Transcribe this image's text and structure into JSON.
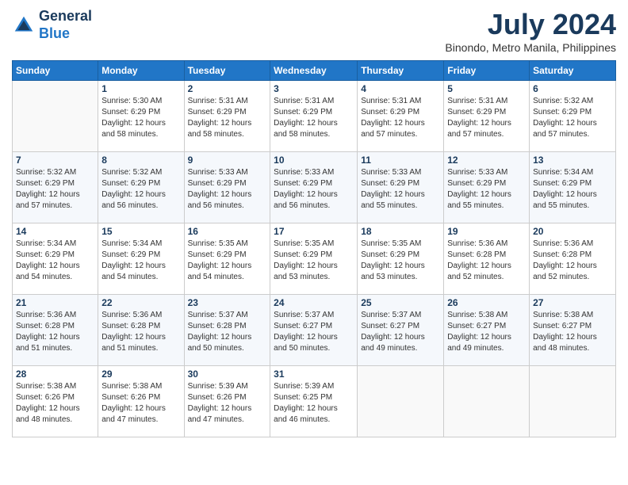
{
  "header": {
    "logo_line1": "General",
    "logo_line2": "Blue",
    "month": "July 2024",
    "location": "Binondo, Metro Manila, Philippines"
  },
  "days_of_week": [
    "Sunday",
    "Monday",
    "Tuesday",
    "Wednesday",
    "Thursday",
    "Friday",
    "Saturday"
  ],
  "weeks": [
    [
      {
        "day": "",
        "info": ""
      },
      {
        "day": "1",
        "info": "Sunrise: 5:30 AM\nSunset: 6:29 PM\nDaylight: 12 hours\nand 58 minutes."
      },
      {
        "day": "2",
        "info": "Sunrise: 5:31 AM\nSunset: 6:29 PM\nDaylight: 12 hours\nand 58 minutes."
      },
      {
        "day": "3",
        "info": "Sunrise: 5:31 AM\nSunset: 6:29 PM\nDaylight: 12 hours\nand 58 minutes."
      },
      {
        "day": "4",
        "info": "Sunrise: 5:31 AM\nSunset: 6:29 PM\nDaylight: 12 hours\nand 57 minutes."
      },
      {
        "day": "5",
        "info": "Sunrise: 5:31 AM\nSunset: 6:29 PM\nDaylight: 12 hours\nand 57 minutes."
      },
      {
        "day": "6",
        "info": "Sunrise: 5:32 AM\nSunset: 6:29 PM\nDaylight: 12 hours\nand 57 minutes."
      }
    ],
    [
      {
        "day": "7",
        "info": "Sunrise: 5:32 AM\nSunset: 6:29 PM\nDaylight: 12 hours\nand 57 minutes."
      },
      {
        "day": "8",
        "info": "Sunrise: 5:32 AM\nSunset: 6:29 PM\nDaylight: 12 hours\nand 56 minutes."
      },
      {
        "day": "9",
        "info": "Sunrise: 5:33 AM\nSunset: 6:29 PM\nDaylight: 12 hours\nand 56 minutes."
      },
      {
        "day": "10",
        "info": "Sunrise: 5:33 AM\nSunset: 6:29 PM\nDaylight: 12 hours\nand 56 minutes."
      },
      {
        "day": "11",
        "info": "Sunrise: 5:33 AM\nSunset: 6:29 PM\nDaylight: 12 hours\nand 55 minutes."
      },
      {
        "day": "12",
        "info": "Sunrise: 5:33 AM\nSunset: 6:29 PM\nDaylight: 12 hours\nand 55 minutes."
      },
      {
        "day": "13",
        "info": "Sunrise: 5:34 AM\nSunset: 6:29 PM\nDaylight: 12 hours\nand 55 minutes."
      }
    ],
    [
      {
        "day": "14",
        "info": "Sunrise: 5:34 AM\nSunset: 6:29 PM\nDaylight: 12 hours\nand 54 minutes."
      },
      {
        "day": "15",
        "info": "Sunrise: 5:34 AM\nSunset: 6:29 PM\nDaylight: 12 hours\nand 54 minutes."
      },
      {
        "day": "16",
        "info": "Sunrise: 5:35 AM\nSunset: 6:29 PM\nDaylight: 12 hours\nand 54 minutes."
      },
      {
        "day": "17",
        "info": "Sunrise: 5:35 AM\nSunset: 6:29 PM\nDaylight: 12 hours\nand 53 minutes."
      },
      {
        "day": "18",
        "info": "Sunrise: 5:35 AM\nSunset: 6:29 PM\nDaylight: 12 hours\nand 53 minutes."
      },
      {
        "day": "19",
        "info": "Sunrise: 5:36 AM\nSunset: 6:28 PM\nDaylight: 12 hours\nand 52 minutes."
      },
      {
        "day": "20",
        "info": "Sunrise: 5:36 AM\nSunset: 6:28 PM\nDaylight: 12 hours\nand 52 minutes."
      }
    ],
    [
      {
        "day": "21",
        "info": "Sunrise: 5:36 AM\nSunset: 6:28 PM\nDaylight: 12 hours\nand 51 minutes."
      },
      {
        "day": "22",
        "info": "Sunrise: 5:36 AM\nSunset: 6:28 PM\nDaylight: 12 hours\nand 51 minutes."
      },
      {
        "day": "23",
        "info": "Sunrise: 5:37 AM\nSunset: 6:28 PM\nDaylight: 12 hours\nand 50 minutes."
      },
      {
        "day": "24",
        "info": "Sunrise: 5:37 AM\nSunset: 6:27 PM\nDaylight: 12 hours\nand 50 minutes."
      },
      {
        "day": "25",
        "info": "Sunrise: 5:37 AM\nSunset: 6:27 PM\nDaylight: 12 hours\nand 49 minutes."
      },
      {
        "day": "26",
        "info": "Sunrise: 5:38 AM\nSunset: 6:27 PM\nDaylight: 12 hours\nand 49 minutes."
      },
      {
        "day": "27",
        "info": "Sunrise: 5:38 AM\nSunset: 6:27 PM\nDaylight: 12 hours\nand 48 minutes."
      }
    ],
    [
      {
        "day": "28",
        "info": "Sunrise: 5:38 AM\nSunset: 6:26 PM\nDaylight: 12 hours\nand 48 minutes."
      },
      {
        "day": "29",
        "info": "Sunrise: 5:38 AM\nSunset: 6:26 PM\nDaylight: 12 hours\nand 47 minutes."
      },
      {
        "day": "30",
        "info": "Sunrise: 5:39 AM\nSunset: 6:26 PM\nDaylight: 12 hours\nand 47 minutes."
      },
      {
        "day": "31",
        "info": "Sunrise: 5:39 AM\nSunset: 6:25 PM\nDaylight: 12 hours\nand 46 minutes."
      },
      {
        "day": "",
        "info": ""
      },
      {
        "day": "",
        "info": ""
      },
      {
        "day": "",
        "info": ""
      }
    ]
  ]
}
